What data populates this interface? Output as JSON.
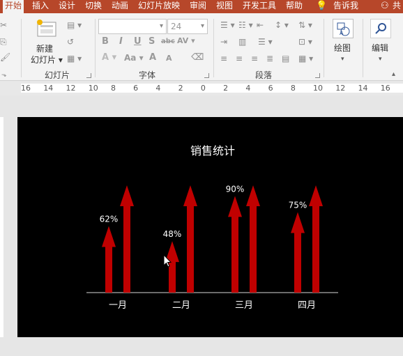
{
  "ribbon": {
    "tabs": [
      "开始",
      "插入",
      "设计",
      "切换",
      "动画",
      "幻灯片放映",
      "审阅",
      "视图",
      "开发工具",
      "帮助",
      "告诉我",
      "共"
    ],
    "active_tab": "开始",
    "groups": {
      "slides": {
        "label": "幻灯片",
        "new_slide": "新建\n幻灯片"
      },
      "font": {
        "label": "字体",
        "font_size": "24"
      },
      "paragraph": {
        "label": "段落"
      },
      "drawing": {
        "label": "绘图"
      },
      "editing": {
        "label": "编辑"
      }
    },
    "accent_color": "#b7472a"
  },
  "ruler": {
    "ticks": [
      "16",
      "14",
      "12",
      "10",
      "8",
      "6",
      "4",
      "2",
      "0",
      "2",
      "4",
      "6",
      "8",
      "10",
      "12",
      "14",
      "16"
    ]
  },
  "chart_data": {
    "type": "bar",
    "title": "销售统计",
    "categories": [
      "一月",
      "二月",
      "三月",
      "四月"
    ],
    "series": [
      {
        "values": [
          62,
          48,
          90,
          75
        ],
        "labels": [
          "62%",
          "48%",
          "90%",
          "75%"
        ]
      },
      {
        "values": [
          100,
          100,
          100,
          100
        ]
      }
    ],
    "ylim": [
      0,
      100
    ],
    "grid": false,
    "bar_shape": "arrow",
    "bar_color": "#c00000",
    "background": "#000000"
  }
}
